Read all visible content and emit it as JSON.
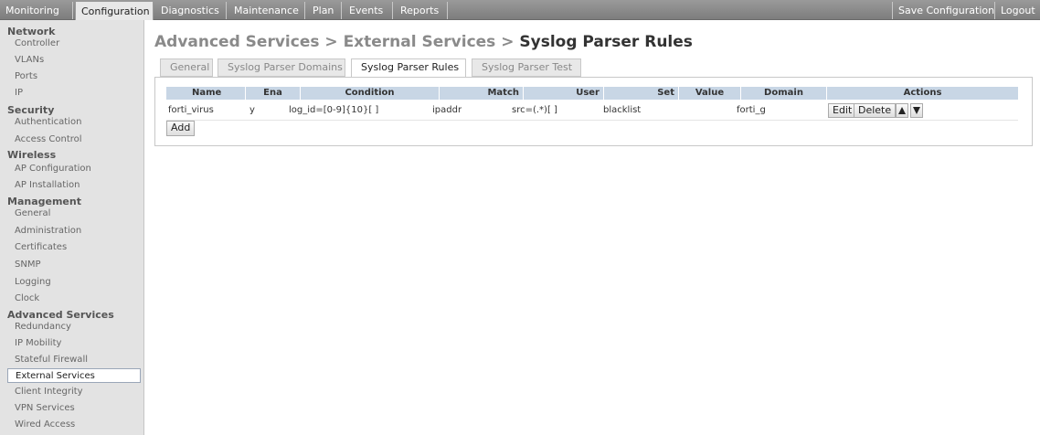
{
  "topnav": {
    "tabs": [
      "Monitoring",
      "Configuration",
      "Diagnostics",
      "Maintenance",
      "Plan",
      "Events",
      "Reports"
    ],
    "active": "Configuration",
    "save_configuration": "Save Configuration",
    "logout": "Logout"
  },
  "sidebar": {
    "network": {
      "label": "Network",
      "items": [
        "Controller",
        "VLANs",
        "Ports",
        "IP"
      ]
    },
    "security": {
      "label": "Security",
      "items": [
        "Authentication",
        "Access Control"
      ]
    },
    "wireless": {
      "label": "Wireless",
      "items": [
        "AP Configuration",
        "AP Installation"
      ]
    },
    "management": {
      "label": "Management",
      "items": [
        "General",
        "Administration",
        "Certificates",
        "SNMP",
        "Logging",
        "Clock"
      ]
    },
    "advanced": {
      "label": "Advanced Services",
      "items": [
        "Redundancy",
        "IP Mobility",
        "Stateful Firewall",
        "External Services",
        "Client Integrity",
        "VPN Services",
        "Wired Access"
      ]
    },
    "selected": "External Services"
  },
  "breadcrumb": {
    "part1": "Advanced Services",
    "sep": ">",
    "part2": "External Services",
    "current": "Syslog Parser Rules"
  },
  "page_tabs": [
    "General",
    "Syslog Parser Domains",
    "Syslog Parser Rules",
    "Syslog Parser Test"
  ],
  "active_page_tab": "Syslog Parser Rules",
  "table": {
    "headers": [
      "Name",
      "Ena",
      "Condition",
      "Match",
      "User",
      "Set",
      "Value",
      "Domain",
      "Actions"
    ],
    "rows": [
      {
        "name": "forti_virus",
        "ena": "y",
        "condition": "log_id=[0-9]{10}[ ]",
        "match": "ipaddr",
        "user": "src=(.*)[ ]",
        "set": "blacklist",
        "value": "",
        "domain": "forti_g"
      }
    ],
    "edit_label": "Edit",
    "delete_label": "Delete",
    "add_label": "Add"
  },
  "icons": {
    "move_up": "triangle-up-icon",
    "move_down": "triangle-down-icon"
  }
}
